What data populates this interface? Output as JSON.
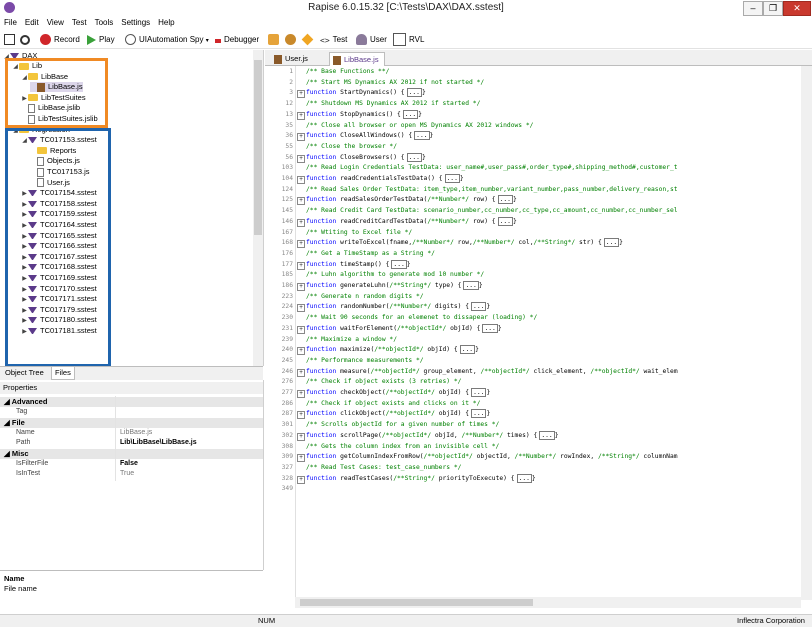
{
  "window": {
    "title": "Rapise 6.0.15.32 [C:\\Tests\\DAX\\DAX.sstest]"
  },
  "menu": [
    "File",
    "Edit",
    "View",
    "Test",
    "Tools",
    "Settings",
    "Help"
  ],
  "toolbar": {
    "record": "Record",
    "play": "Play",
    "spy": "UIAutomation Spy",
    "debugger": "Debugger",
    "test": "Test",
    "user": "User",
    "rvl": "RVL"
  },
  "tree": {
    "root": "DAX",
    "nodes": [
      {
        "label": "Lib",
        "kind": "folder",
        "indent": 1,
        "arrow": "open"
      },
      {
        "label": "LibBase",
        "kind": "folder",
        "indent": 2,
        "arrow": "open"
      },
      {
        "label": "LibBase.js",
        "kind": "js",
        "indent": 3,
        "arrow": "",
        "selected": true
      },
      {
        "label": "LibTestSuites",
        "kind": "folder",
        "indent": 2,
        "arrow": "closed"
      },
      {
        "label": "LibBase.jslib",
        "kind": "file",
        "indent": 2,
        "arrow": ""
      },
      {
        "label": "LibTestSuites.jslib",
        "kind": "file",
        "indent": 2,
        "arrow": ""
      },
      {
        "label": "Regression",
        "kind": "folder",
        "indent": 1,
        "arrow": "open"
      },
      {
        "label": "TC017153.sstest",
        "kind": "test",
        "indent": 2,
        "arrow": "open"
      },
      {
        "label": "Reports",
        "kind": "folder",
        "indent": 3,
        "arrow": ""
      },
      {
        "label": "Objects.js",
        "kind": "file",
        "indent": 3,
        "arrow": ""
      },
      {
        "label": "TC017153.js",
        "kind": "file",
        "indent": 3,
        "arrow": ""
      },
      {
        "label": "User.js",
        "kind": "file",
        "indent": 3,
        "arrow": ""
      },
      {
        "label": "TC017154.sstest",
        "kind": "test",
        "indent": 2,
        "arrow": "closed"
      },
      {
        "label": "TC017158.sstest",
        "kind": "test",
        "indent": 2,
        "arrow": "closed"
      },
      {
        "label": "TC017159.sstest",
        "kind": "test",
        "indent": 2,
        "arrow": "closed"
      },
      {
        "label": "TC017164.sstest",
        "kind": "test",
        "indent": 2,
        "arrow": "closed"
      },
      {
        "label": "TC017165.sstest",
        "kind": "test",
        "indent": 2,
        "arrow": "closed"
      },
      {
        "label": "TC017166.sstest",
        "kind": "test",
        "indent": 2,
        "arrow": "closed"
      },
      {
        "label": "TC017167.sstest",
        "kind": "test",
        "indent": 2,
        "arrow": "closed"
      },
      {
        "label": "TC017168.sstest",
        "kind": "test",
        "indent": 2,
        "arrow": "closed"
      },
      {
        "label": "TC017169.sstest",
        "kind": "test",
        "indent": 2,
        "arrow": "closed"
      },
      {
        "label": "TC017170.sstest",
        "kind": "test",
        "indent": 2,
        "arrow": "closed"
      },
      {
        "label": "TC017171.sstest",
        "kind": "test",
        "indent": 2,
        "arrow": "closed"
      },
      {
        "label": "TC017179.sstest",
        "kind": "test",
        "indent": 2,
        "arrow": "closed"
      },
      {
        "label": "TC017180.sstest",
        "kind": "test",
        "indent": 2,
        "arrow": "closed"
      },
      {
        "label": "TC017181.sstest",
        "kind": "test",
        "indent": 2,
        "arrow": "closed"
      }
    ],
    "tabs": [
      "Object Tree",
      "Files"
    ]
  },
  "properties": {
    "header": "Properties",
    "groups": [
      {
        "name": "Advanced",
        "rows": [
          {
            "k": "Tag",
            "v": ""
          }
        ]
      },
      {
        "name": "File",
        "rows": [
          {
            "k": "Name",
            "v": "LibBase.js"
          },
          {
            "k": "Path",
            "v": "Lib\\LibBase\\LibBase.js",
            "bold": true
          }
        ]
      },
      {
        "name": "Misc",
        "rows": [
          {
            "k": "IsFilterFile",
            "v": "False",
            "bold": true
          },
          {
            "k": "IsInTest",
            "v": "True"
          }
        ]
      }
    ],
    "help_title": "Name",
    "help_text": "File name"
  },
  "editor": {
    "tabs": [
      {
        "label": "User.js",
        "active": false
      },
      {
        "label": "LibBase.js",
        "active": true
      }
    ],
    "lines": [
      {
        "n": "1",
        "fold": false,
        "t": [
          [
            "c",
            "/** Base Functions **/"
          ]
        ]
      },
      {
        "n": "2",
        "fold": false,
        "t": [
          [
            "c",
            "/** Start MS Dynamics AX 2012 if not started */"
          ]
        ]
      },
      {
        "n": "3",
        "fold": true,
        "t": [
          [
            "k",
            "function "
          ],
          [
            "",
            "StartDynamics() "
          ]
        ],
        "e": true
      },
      {
        "n": "12",
        "fold": false,
        "t": [
          [
            "c",
            "/** Shutdown MS Dynamics AX 2012 if started */"
          ]
        ]
      },
      {
        "n": "13",
        "fold": true,
        "t": [
          [
            "k",
            "function "
          ],
          [
            "",
            "StopDynamics() "
          ]
        ],
        "e": true
      },
      {
        "n": "35",
        "fold": false,
        "t": [
          [
            "c",
            "/** Close all browser or open MS Dynamics AX 2012 windows */"
          ]
        ]
      },
      {
        "n": "36",
        "fold": true,
        "t": [
          [
            "k",
            "function "
          ],
          [
            "",
            "CloseAllWindows() "
          ]
        ],
        "e": true
      },
      {
        "n": "55",
        "fold": false,
        "t": [
          [
            "c",
            "/** Close the browser */"
          ]
        ]
      },
      {
        "n": "56",
        "fold": true,
        "t": [
          [
            "k",
            "function "
          ],
          [
            "",
            "CloseBrowsers() "
          ]
        ],
        "e": true
      },
      {
        "n": "103",
        "fold": false,
        "t": [
          [
            "c",
            "/** Read Login Credentials TestData: user_name#,user_pass#,order_type#,shipping_method#,customer_t"
          ]
        ]
      },
      {
        "n": "104",
        "fold": true,
        "t": [
          [
            "k",
            "function "
          ],
          [
            "",
            "readCredentialsTestData() "
          ]
        ],
        "e": true
      },
      {
        "n": "124",
        "fold": false,
        "t": [
          [
            "c",
            "/** Read Sales Order TestData: item_type,item_number,variant_number,pass_number,delivery_reason,st"
          ]
        ]
      },
      {
        "n": "125",
        "fold": true,
        "t": [
          [
            "k",
            "function "
          ],
          [
            "",
            "readSalesOrderTestData("
          ],
          [
            "c",
            "/**Number*/"
          ],
          [
            "",
            " row) "
          ]
        ],
        "e": true
      },
      {
        "n": "145",
        "fold": false,
        "t": [
          [
            "c",
            "/** Read Credit Card TestData: scenario_number,cc_number,cc_type,cc_amount,cc_number,cc_number_sel"
          ]
        ]
      },
      {
        "n": "146",
        "fold": true,
        "t": [
          [
            "k",
            "function "
          ],
          [
            "",
            "readCreditCardTestData("
          ],
          [
            "c",
            "/**Number*/"
          ],
          [
            "",
            " row) "
          ]
        ],
        "e": true
      },
      {
        "n": "167",
        "fold": false,
        "t": [
          [
            "c",
            "/** Wtiting to Excel file */"
          ]
        ]
      },
      {
        "n": "168",
        "fold": true,
        "t": [
          [
            "k",
            "function "
          ],
          [
            "",
            "writeToExcel(fname,"
          ],
          [
            "c",
            "/**Number*/"
          ],
          [
            "",
            " row,"
          ],
          [
            "c",
            "/**Number*/"
          ],
          [
            "",
            " col,"
          ],
          [
            "c",
            "/**String*/"
          ],
          [
            "",
            " str) "
          ]
        ],
        "e": true
      },
      {
        "n": "176",
        "fold": false,
        "t": [
          [
            "c",
            "/** Get a TimeStamp as a String */"
          ]
        ]
      },
      {
        "n": "177",
        "fold": true,
        "t": [
          [
            "k",
            "function "
          ],
          [
            "",
            "timeStamp() "
          ]
        ],
        "e": true
      },
      {
        "n": "185",
        "fold": false,
        "t": [
          [
            "c",
            "/** Luhn algorithm to generate mod 10 number */"
          ]
        ]
      },
      {
        "n": "186",
        "fold": true,
        "t": [
          [
            "k",
            "function "
          ],
          [
            "",
            "generateLuhn("
          ],
          [
            "c",
            "/**String*/"
          ],
          [
            "",
            " type) "
          ]
        ],
        "e": true
      },
      {
        "n": "223",
        "fold": false,
        "t": [
          [
            "c",
            "/** Generate n random digits */"
          ]
        ]
      },
      {
        "n": "224",
        "fold": true,
        "t": [
          [
            "k",
            "function "
          ],
          [
            "",
            "randomNumber("
          ],
          [
            "c",
            "/**Number*/"
          ],
          [
            "",
            " digits) "
          ]
        ],
        "e": true
      },
      {
        "n": "230",
        "fold": false,
        "t": [
          [
            "c",
            "/** Wait 90 seconds for an elemenet to dissapear (loading) */"
          ]
        ]
      },
      {
        "n": "231",
        "fold": true,
        "t": [
          [
            "k",
            "function "
          ],
          [
            "",
            "waitForElement("
          ],
          [
            "c",
            "/**objectId*/"
          ],
          [
            "",
            " objId) "
          ]
        ],
        "e": true
      },
      {
        "n": "239",
        "fold": false,
        "t": [
          [
            "c",
            "/** Maximize a window */"
          ]
        ]
      },
      {
        "n": "240",
        "fold": true,
        "t": [
          [
            "k",
            "function "
          ],
          [
            "",
            "maximize("
          ],
          [
            "c",
            "/**objectId*/"
          ],
          [
            "",
            " objId) "
          ]
        ],
        "e": true
      },
      {
        "n": "245",
        "fold": false,
        "t": [
          [
            "c",
            "/** Performance measurements */"
          ]
        ]
      },
      {
        "n": "246",
        "fold": true,
        "t": [
          [
            "k",
            "function "
          ],
          [
            "",
            "measure("
          ],
          [
            "c",
            "/**objectId*/"
          ],
          [
            "",
            " group_element, "
          ],
          [
            "c",
            "/**objectId*/"
          ],
          [
            "",
            " click_element, "
          ],
          [
            "c",
            "/**objectId*/"
          ],
          [
            "",
            " wait_elem"
          ]
        ],
        "e": false
      },
      {
        "n": "276",
        "fold": false,
        "t": [
          [
            "c",
            "/** Check if object exists (3 retries) */"
          ]
        ]
      },
      {
        "n": "277",
        "fold": true,
        "t": [
          [
            "k",
            "function "
          ],
          [
            "",
            "checkObject("
          ],
          [
            "c",
            "/**objectId*/"
          ],
          [
            "",
            " objId) "
          ]
        ],
        "e": true
      },
      {
        "n": "286",
        "fold": false,
        "t": [
          [
            "c",
            "/** Check if object exists and clicks on it */"
          ]
        ]
      },
      {
        "n": "287",
        "fold": true,
        "t": [
          [
            "k",
            "function "
          ],
          [
            "",
            "clickObject("
          ],
          [
            "c",
            "/**objectId*/"
          ],
          [
            "",
            " objId) "
          ]
        ],
        "e": true
      },
      {
        "n": "301",
        "fold": false,
        "t": [
          [
            "c",
            "/** Scrolls objectId for a given number of times */"
          ]
        ]
      },
      {
        "n": "302",
        "fold": true,
        "t": [
          [
            "k",
            "function "
          ],
          [
            "",
            "scrollPage("
          ],
          [
            "c",
            "/**objectId*/"
          ],
          [
            "",
            " objId, "
          ],
          [
            "c",
            "/**Number*/"
          ],
          [
            "",
            " times) "
          ]
        ],
        "e": true
      },
      {
        "n": "308",
        "fold": false,
        "t": [
          [
            "c",
            "/** Gets the column index from an invisible cell */"
          ]
        ]
      },
      {
        "n": "309",
        "fold": true,
        "t": [
          [
            "k",
            "function "
          ],
          [
            "",
            "getColumnIndexFromRow("
          ],
          [
            "c",
            "/**objectId*/"
          ],
          [
            "",
            " objectId, "
          ],
          [
            "c",
            "/**Number*/"
          ],
          [
            "",
            " rowIndex, "
          ],
          [
            "c",
            "/**String*/"
          ],
          [
            "",
            " columnNam"
          ]
        ],
        "e": false
      },
      {
        "n": "327",
        "fold": false,
        "t": [
          [
            "c",
            "/** Read Test Cases: test_case_numbers */"
          ]
        ]
      },
      {
        "n": "328",
        "fold": true,
        "t": [
          [
            "k",
            "function "
          ],
          [
            "",
            "readTestCases("
          ],
          [
            "c",
            "/**String*/"
          ],
          [
            "",
            " priorityToExecute) "
          ]
        ],
        "e": true
      },
      {
        "n": "349",
        "fold": false,
        "t": []
      }
    ]
  },
  "status": {
    "num": "NUM",
    "company": "Inflectra Corporation"
  }
}
